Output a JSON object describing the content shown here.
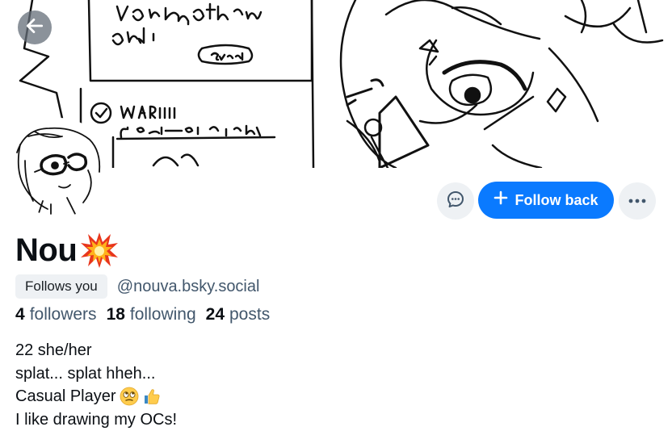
{
  "banner": {
    "icon": "banner-image"
  },
  "nav": {
    "back_icon": "arrow-left-icon"
  },
  "profile": {
    "display_name": "Nou",
    "name_emoji": "collision-emoji",
    "follows_you_label": "Follows you",
    "handle": "@nouva.bsky.social",
    "stats": [
      {
        "count": "4",
        "label": "followers"
      },
      {
        "count": "18",
        "label": "following"
      },
      {
        "count": "24",
        "label": "posts"
      }
    ],
    "bio": [
      "22 she/her",
      "splat... splat hheh...",
      "Casual Player",
      "I like drawing my OCs!"
    ]
  },
  "actions": {
    "message_icon": "chat-bubble-icon",
    "follow_label": "Follow back",
    "more_icon": "ellipsis-icon"
  },
  "colors": {
    "accent": "#0a7aff",
    "muted_text": "#42576c",
    "button_bg": "#eef1f4"
  }
}
